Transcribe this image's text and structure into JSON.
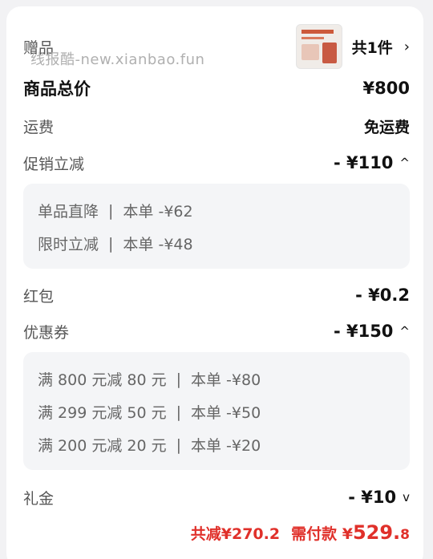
{
  "gift": {
    "label": "赠品",
    "count": "共1件",
    "arrow": "›"
  },
  "watermark": "线报酷-new.xianbao.fun",
  "total": {
    "label": "商品总价",
    "value": "¥800"
  },
  "shipping": {
    "label": "运费",
    "value": "免运费"
  },
  "promotion": {
    "label": "促销立减",
    "value": "- ¥110",
    "chevron": "^",
    "details": [
      {
        "name": "单品直降",
        "scope": "本单 -¥62"
      },
      {
        "name": "限时立减",
        "scope": "本单 -¥48"
      }
    ]
  },
  "redpacket": {
    "label": "红包",
    "value": "- ¥0.2"
  },
  "coupon": {
    "label": "优惠券",
    "value": "- ¥150",
    "chevron": "^",
    "details": [
      {
        "name": "满 800 元减 80 元",
        "scope": "本单 -¥80"
      },
      {
        "name": "满 299 元减 50 元",
        "scope": "本单 -¥50"
      },
      {
        "name": "满 200 元减 20 元",
        "scope": "本单 -¥20"
      }
    ]
  },
  "cashgift": {
    "label": "礼金",
    "value": "- ¥10",
    "chevron": "v"
  },
  "footer": {
    "saved": "共减¥270.2",
    "pay_label": "需付款 ¥",
    "pay_main": "529.",
    "pay_decimal": "8"
  },
  "colors": {
    "accent_red": "#e0302a",
    "subbox_bg": "#f4f5f7"
  }
}
